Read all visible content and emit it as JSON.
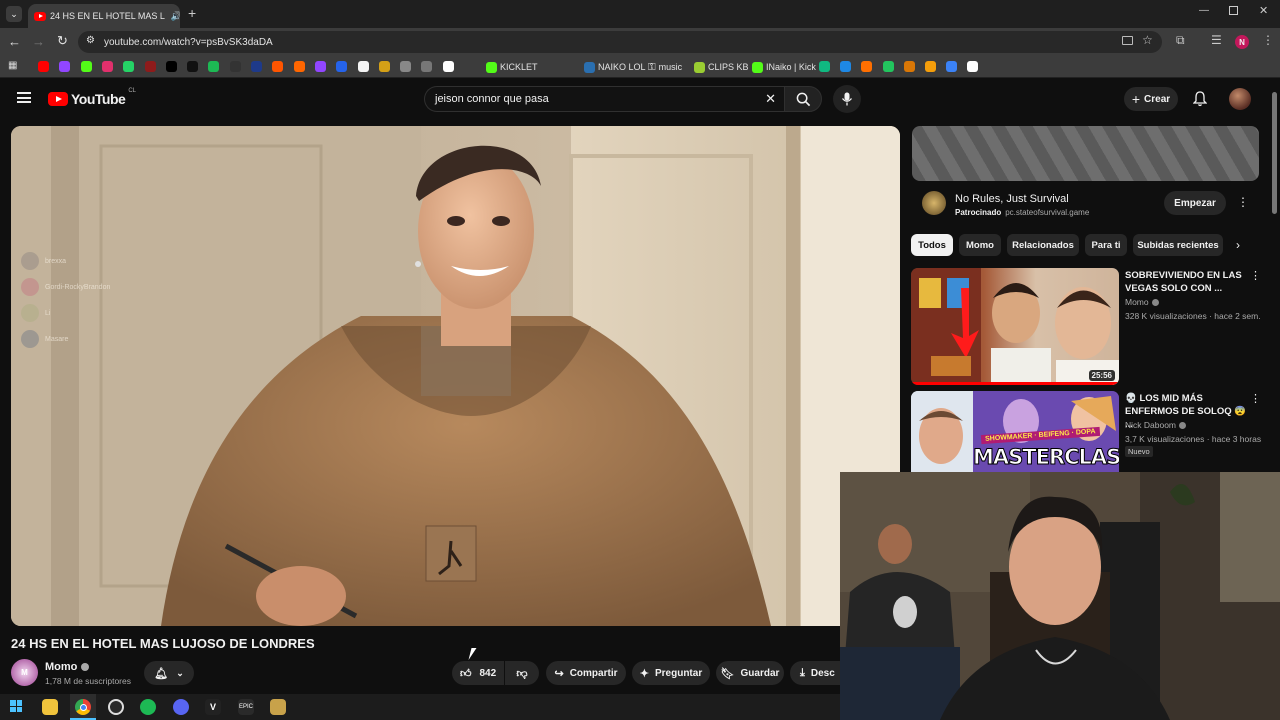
{
  "browser": {
    "tab_title": "24 HS EN EL HOTEL MAS L",
    "url": "youtube.com/watch?v=psBvSK3daDA",
    "bookmarks": [
      "KICKLET",
      "NAIKO LOL",
      "music",
      "CLIPS KB",
      "INaiko | Kick"
    ],
    "profile_initial": "N"
  },
  "youtube": {
    "logo": "YouTube",
    "country": "CL",
    "search_value": "jeison connor que pasa",
    "create_label": "Crear"
  },
  "video": {
    "title": "24 HS EN EL HOTEL MAS LUJOSO DE LONDRES",
    "channel": "Momo",
    "subscribers": "1,78 M de suscriptores",
    "likes": "842",
    "share_label": "Compartir",
    "ask_label": "Preguntar",
    "save_label": "Guardar",
    "download_label": "Desc",
    "overlay_names": [
      "brexxa",
      "Gordi-RockyBrandon",
      "Li",
      "Masare"
    ]
  },
  "ad": {
    "title": "No Rules, Just Survival",
    "sponsored": "Patrocinado",
    "domain": "pc.stateofsurvival.game",
    "cta": "Empezar"
  },
  "chips": [
    "Todos",
    "Momo",
    "Relacionados",
    "Para ti",
    "Subidas recientes"
  ],
  "recommendations": [
    {
      "title_line1": "SOBREVIVIENDO EN LAS",
      "title_line2": "VEGAS SOLO CON ...",
      "channel": "Momo",
      "meta": "328 K visualizaciones · hace 2 sem...",
      "duration": "25:56"
    },
    {
      "title_line1": "💀 LOS MID MÁS",
      "title_line2": "ENFERMOS DE SOLOQ 😨 ...",
      "channel": "Nick Daboom",
      "meta": "3,7 K visualizaciones · hace 3 horas",
      "badge": "Nuevo",
      "thumb_banner": "SHOWMAKER · BEIFENG · DOPA",
      "thumb_text": "MASTERCLASS"
    }
  ],
  "colors": {
    "accent": "#ff0000",
    "background": "#0f0f0f",
    "hoodie": "#a57a52"
  }
}
